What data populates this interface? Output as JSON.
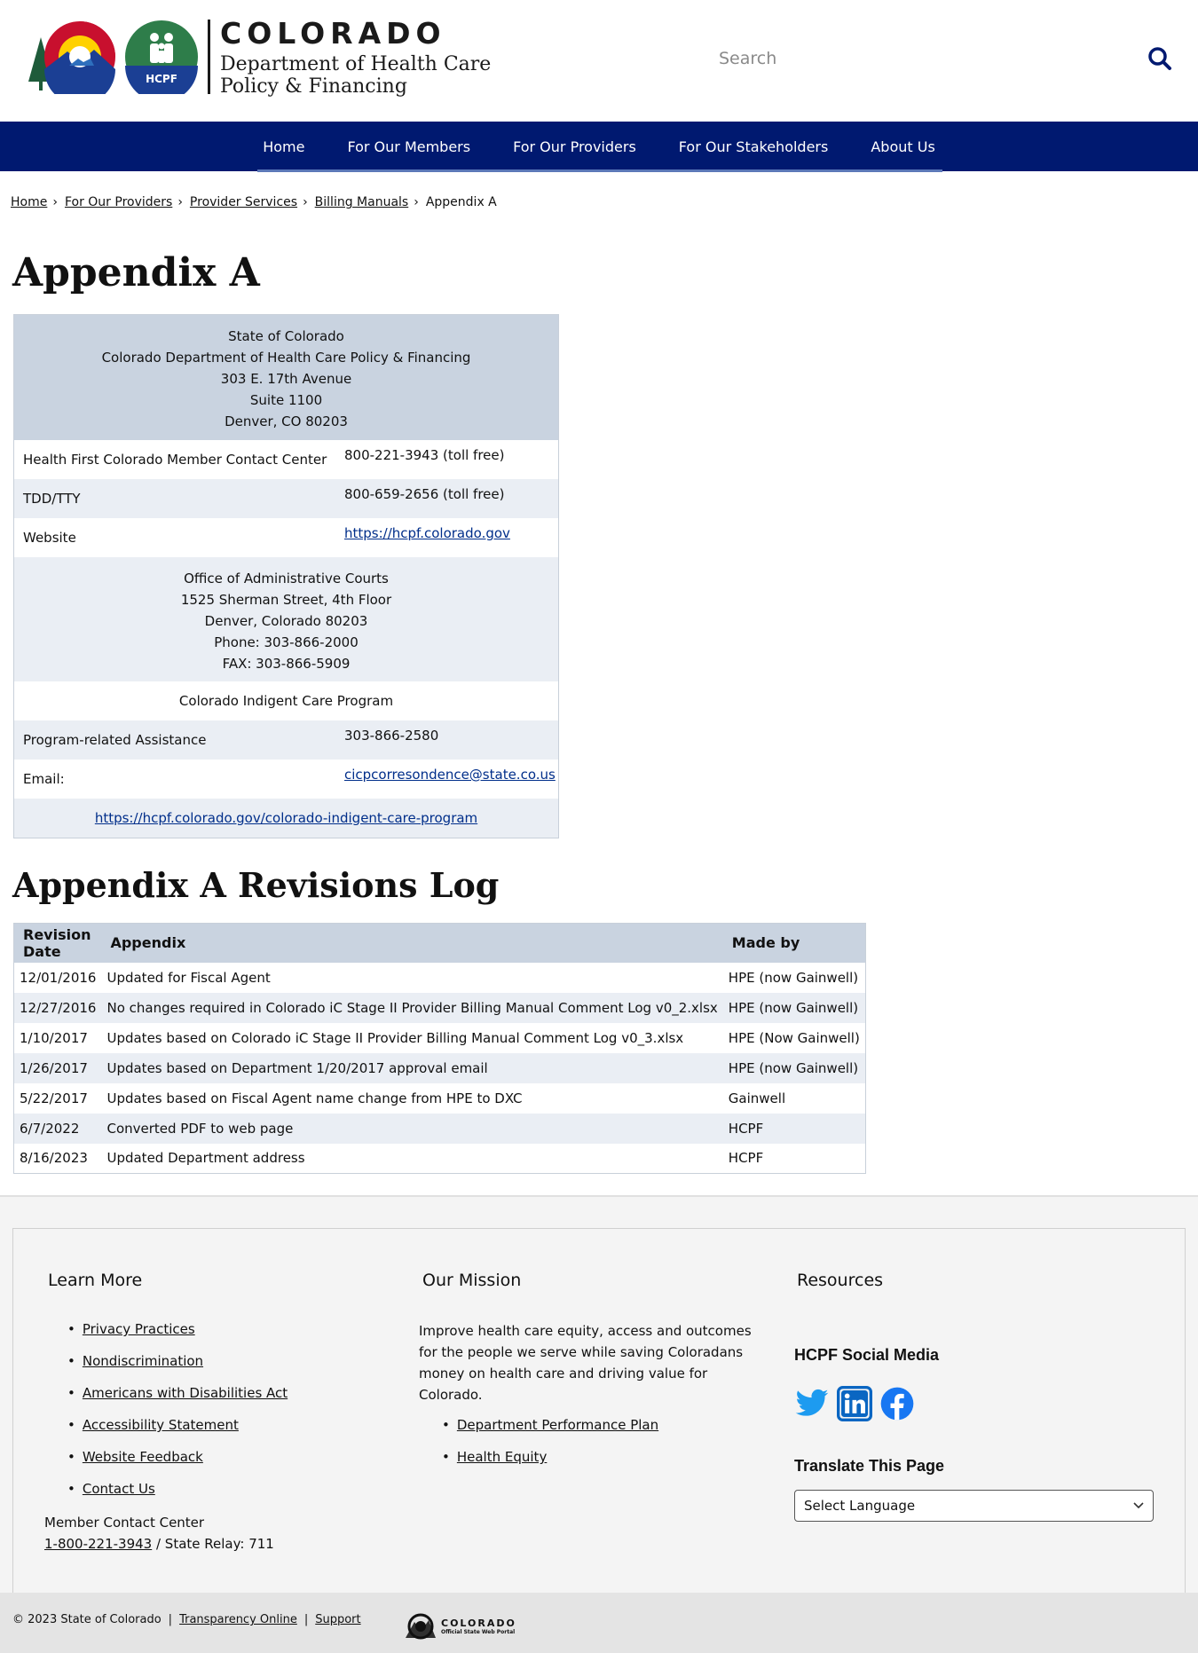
{
  "header": {
    "brand_title": "COLORADO",
    "brand_sub_line1": "Department of Health Care",
    "brand_sub_line2": "Policy & Financing",
    "hcpf_logo_text": "HCPF",
    "search_placeholder": "Search"
  },
  "nav": {
    "items": [
      "Home",
      "For Our Members",
      "For Our Providers",
      "For Our Stakeholders",
      "About Us"
    ]
  },
  "breadcrumb": {
    "items": [
      "Home",
      "For Our Providers",
      "Provider Services",
      "Billing Manuals"
    ],
    "current": "Appendix A",
    "separator": "›"
  },
  "page_title": "Appendix A",
  "contact": {
    "head_lines": [
      "State of Colorado",
      "Colorado Department of Health Care Policy & Financing",
      "303 E. 17th Avenue",
      "Suite 1100",
      "Denver, CO 80203"
    ],
    "rows": [
      {
        "key": "Health First Colorado Member Contact Center",
        "value": "800-221-3943 (toll free)"
      },
      {
        "key": "TDD/TTY",
        "value": "800-659-2656 (toll free)"
      },
      {
        "key": "Website",
        "value": "https://hcpf.colorado.gov"
      }
    ],
    "office_lines": [
      "Office of Administrative Courts",
      "1525 Sherman Street, 4th Floor",
      "Denver, Colorado 80203",
      "Phone: 303-866-2000",
      "FAX: 303-866-5909"
    ],
    "cicp_title": "Colorado Indigent Care Program",
    "cicp_rows": [
      {
        "key": "Program-related Assistance",
        "value": "303-866-2580"
      },
      {
        "key": "Email:",
        "value": "cicpcorresondence@state.co.us"
      }
    ],
    "cicp_link": "https://hcpf.colorado.gov/colorado-indigent-care-program"
  },
  "revisions": {
    "title": "Appendix A Revisions Log",
    "headers": [
      "Revision Date",
      "Appendix",
      "Made by"
    ],
    "rows": [
      [
        "12/01/2016",
        "Updated for Fiscal Agent",
        "HPE (now Gainwell)"
      ],
      [
        "12/27/2016",
        "No changes required in Colorado iC Stage II Provider Billing Manual Comment Log v0_2.xlsx",
        "HPE (now Gainwell)"
      ],
      [
        "1/10/2017",
        "Updates based on Colorado iC Stage II Provider Billing Manual Comment Log v0_3.xlsx",
        "HPE (Now Gainwell)"
      ],
      [
        "1/26/2017",
        "Updates based on Department 1/20/2017 approval email",
        "HPE (now Gainwell)"
      ],
      [
        "5/22/2017",
        "Updates based on Fiscal Agent name change from HPE to DXC",
        "Gainwell"
      ],
      [
        "6/7/2022",
        "Converted PDF to web page",
        "HCPF"
      ],
      [
        "8/16/2023",
        "Updated Department address",
        "HCPF"
      ]
    ]
  },
  "footer": {
    "learn_more": {
      "title": "Learn More",
      "links": [
        "Privacy Practices",
        "Nondiscrimination",
        "Americans with Disabilities Act",
        "Accessibility Statement",
        "Website Feedback",
        "Contact Us"
      ]
    },
    "member_contact": {
      "label": "Member Contact Center",
      "phone": "1-800-221-3943",
      "relay": " / State Relay: 711"
    },
    "mission": {
      "title": "Our Mission",
      "text": "Improve health care equity, access and outcomes for the people we serve while saving Coloradans money on health care and driving value for Colorado.",
      "links": [
        "Department Performance Plan",
        "Health Equity"
      ]
    },
    "resources": {
      "title": "Resources",
      "social_title": "HCPF Social Media",
      "social_icons": [
        "twitter-icon",
        "linkedin-icon",
        "facebook-icon"
      ],
      "translate_title": "Translate This Page",
      "select_value": "Select Language"
    }
  },
  "bottom": {
    "copyright": "© 2023 State of Colorado",
    "sep": "|",
    "links": [
      "Transparency Online",
      "Support"
    ],
    "portal_title": "COLORADO",
    "portal_sub": "Official State Web Portal"
  },
  "colors": {
    "nav_bg": "#001970",
    "table_head": "#c9d3e0",
    "row_alt": "#eaeef4",
    "link_blue": "#002e8a",
    "twitter": "#1d9bf0",
    "linkedin": "#0a66c2",
    "facebook": "#1877f2"
  }
}
